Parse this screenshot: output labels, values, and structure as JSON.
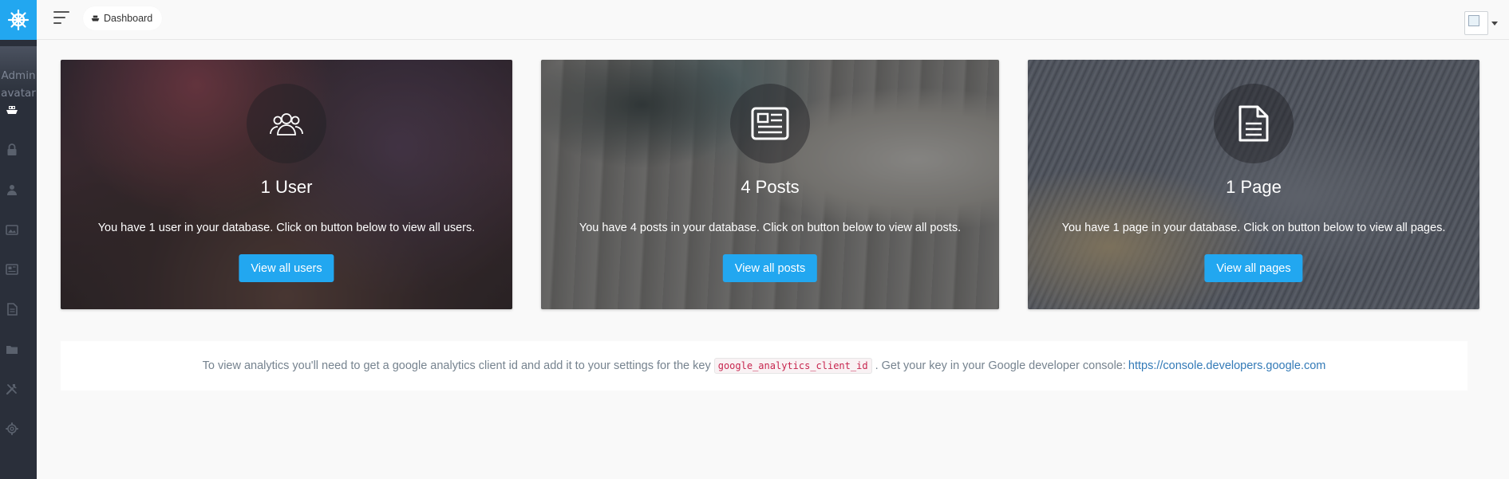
{
  "sidebar": {
    "logo_icon": "helm-icon",
    "avatar_alt": "Admin avatar",
    "items": [
      {
        "name": "dashboard",
        "icon": "boat-icon"
      },
      {
        "name": "roles",
        "icon": "lock-icon"
      },
      {
        "name": "users",
        "icon": "person-icon"
      },
      {
        "name": "media",
        "icon": "image-icon"
      },
      {
        "name": "posts",
        "icon": "news-icon"
      },
      {
        "name": "pages",
        "icon": "file-icon"
      },
      {
        "name": "categories",
        "icon": "folder-icon"
      },
      {
        "name": "tools",
        "icon": "tools-icon"
      },
      {
        "name": "settings",
        "icon": "gear-icon"
      }
    ]
  },
  "header": {
    "breadcrumb": "Dashboard"
  },
  "cards": [
    {
      "title": "1 User",
      "description": "You have 1 user in your database. Click on button below to view all users.",
      "button": "View all users",
      "icon": "users-icon"
    },
    {
      "title": "4 Posts",
      "description": "You have 4 posts in your database. Click on button below to view all posts.",
      "button": "View all posts",
      "icon": "news-icon"
    },
    {
      "title": "1 Page",
      "description": "You have 1 page in your database. Click on button below to view all pages.",
      "button": "View all pages",
      "icon": "file-text-icon"
    }
  ],
  "analytics": {
    "text_before": "To view analytics you'll need to get a google analytics client id and add it to your settings for the key",
    "key": "google_analytics_client_id",
    "text_after": ". Get your key in your Google developer console:",
    "link": "https://console.developers.google.com"
  },
  "colors": {
    "accent": "#22a7f0",
    "sidebar_bg": "#2a2f3a"
  }
}
